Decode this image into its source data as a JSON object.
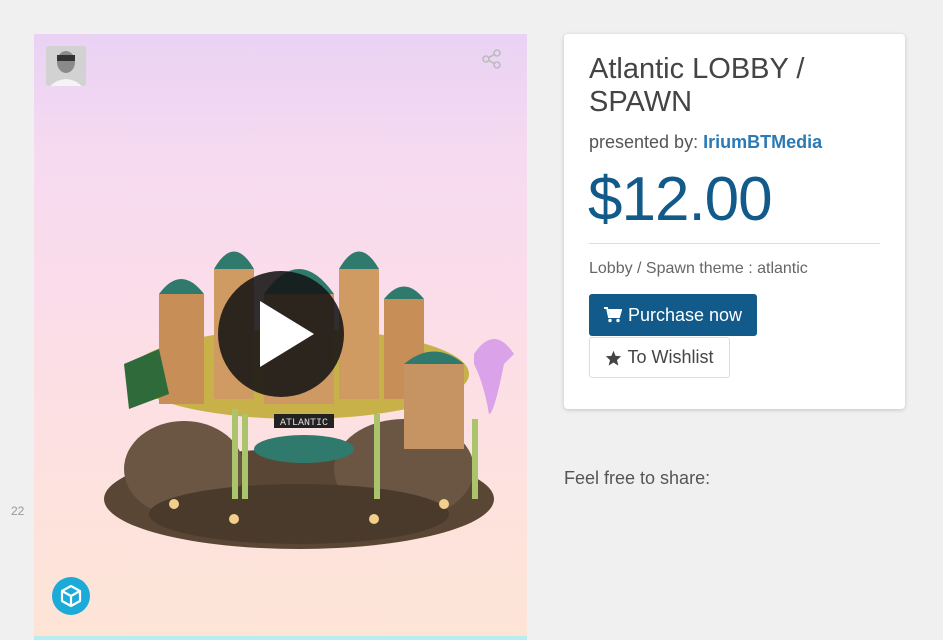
{
  "side_number": "22",
  "product": {
    "title": "Atlantic LOBBY / SPAWN",
    "presented_label": "presented by: ",
    "author": "IriumBTMedia",
    "price": "$12.00",
    "theme": "Lobby / Spawn theme : atlantic"
  },
  "actions": {
    "purchase_label": "Purchase now",
    "wishlist_label": "To Wishlist"
  },
  "share_label": "Feel free to share:",
  "viewer": {
    "sign_text": "ATLANTIC",
    "icons": [
      "avatar",
      "share-icon",
      "play-icon",
      "sketchfab-cube-icon"
    ]
  },
  "colors": {
    "price": "#125a8a",
    "author_link": "#2a7ab5",
    "button": "#125a8a",
    "sketchfab": "#1caad9"
  }
}
